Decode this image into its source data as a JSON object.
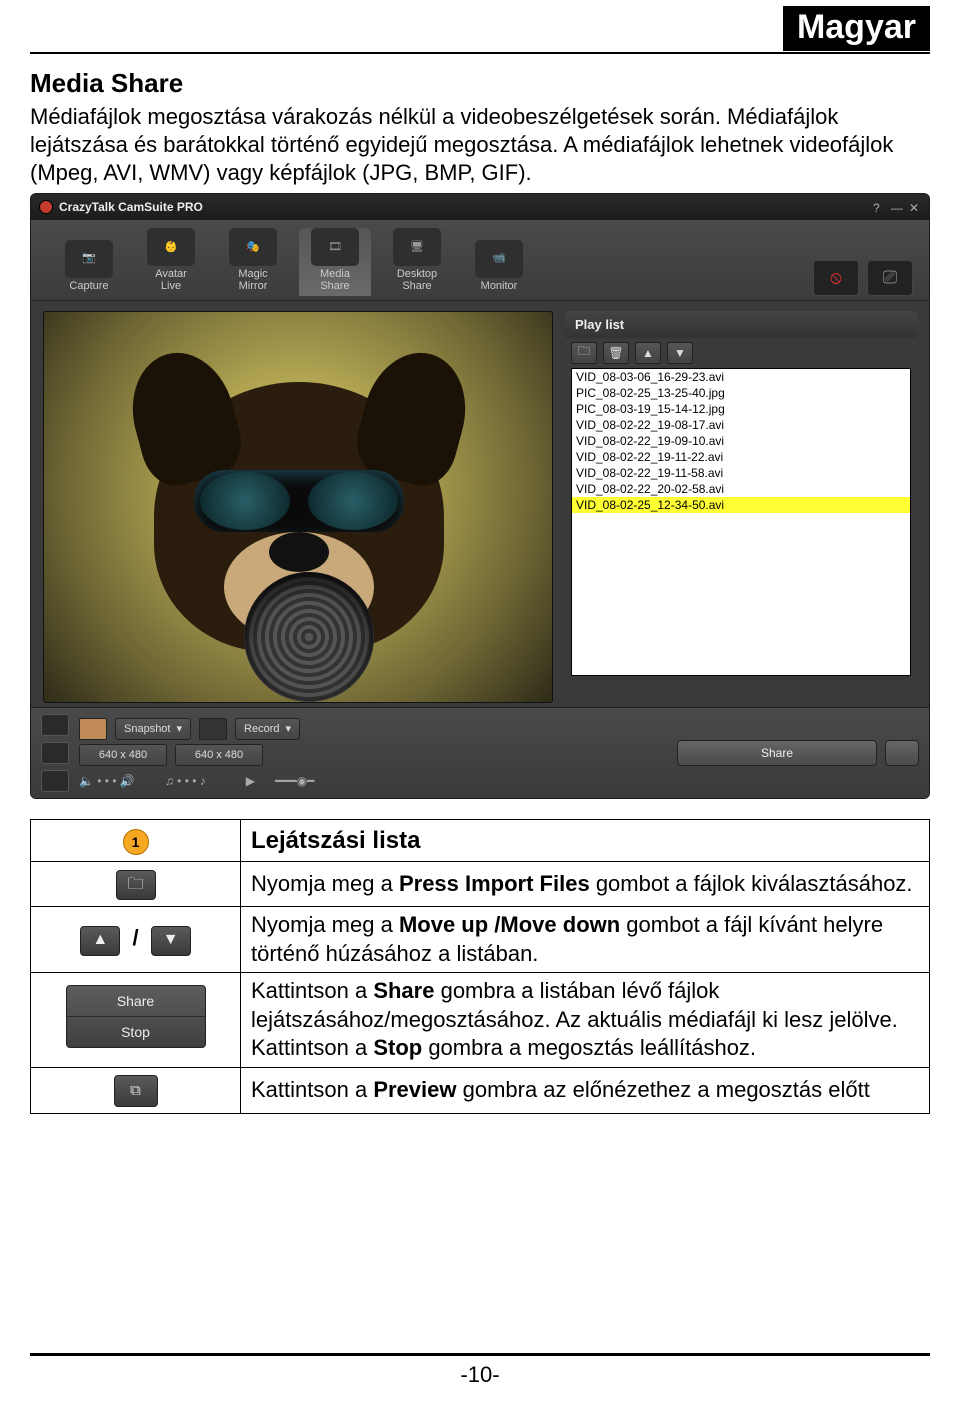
{
  "page": {
    "language_banner": "Magyar",
    "number": "-10-"
  },
  "section": {
    "title": "Media Share",
    "p1": "Médiafájlok megosztása várakozás nélkül a videobeszélgetések során. Médiafájlok lejátszása és barátokkal történő egyidejű megosztása. A médiafájlok lehetnek videofájlok (Mpeg, AVI, WMV) vagy képfájlok (JPG, BMP, GIF)."
  },
  "app": {
    "title": "CrazyTalk CamSuite PRO",
    "toolbar": {
      "capture": "Capture",
      "avatar_live": "Avatar\nLive",
      "magic_mirror": "Magic\nMirror",
      "media_share": "Media\nShare",
      "desktop_share": "Desktop\nShare",
      "monitor": "Monitor"
    },
    "playlist": {
      "title": "Play list",
      "items": [
        "VID_08-03-06_16-29-23.avi",
        "PIC_08-02-25_13-25-40.jpg",
        "PIC_08-03-19_15-14-12.jpg",
        "VID_08-02-22_19-08-17.avi",
        "VID_08-02-22_19-09-10.avi",
        "VID_08-02-22_19-11-22.avi",
        "VID_08-02-22_19-11-58.avi",
        "VID_08-02-22_20-02-58.avi",
        "VID_08-02-25_12-34-50.avi"
      ],
      "selected_index": 8
    },
    "bottom": {
      "snapshot_label": "Snapshot",
      "record_label": "Record",
      "res": "640 x 480",
      "share_label": "Share"
    }
  },
  "rows": {
    "r1_label": "Lejátszási lista",
    "r2_pre": "Nyomja meg a ",
    "r2_bold": "Press Import Files",
    "r2_post": " gombot a fájlok kiválasztásához.",
    "r3_pre": "Nyomja meg a ",
    "r3_bold": "Move up /Move down",
    "r3_post": " gombot a fájl kívánt helyre történő húzásához a listában.",
    "r4_pre": "Kattintson a ",
    "r4_bold1": "Share",
    "r4_mid": " gombra a listában lévő fájlok lejátszásához/megosztásához. Az aktuális médiafájl ki lesz jelölve. Kattintson a ",
    "r4_bold2": "Stop",
    "r4_post": " gombra a megosztás leállításhoz.",
    "r5_pre": "Kattintson a ",
    "r5_bold": "Preview",
    "r5_post": " gombra az előnézethez a megosztás előtt"
  },
  "icons": {
    "share_btn": "Share",
    "stop_btn": "Stop"
  }
}
